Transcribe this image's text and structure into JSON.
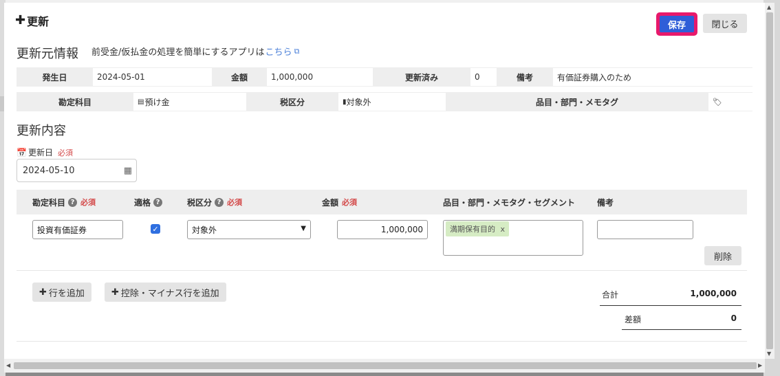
{
  "header": {
    "title": "更新",
    "save_label": "保存",
    "close_label": "閉じる"
  },
  "source": {
    "heading": "更新元情報",
    "subtitle": "前受金/仮払金の処理を簡単にするアプリは",
    "link_text": "こちら",
    "row1": {
      "date_label": "発生日",
      "date_value": "2024-05-01",
      "amount_label": "金額",
      "amount_value": "1,000,000",
      "updated_label": "更新済み",
      "updated_value": "0",
      "note_label": "備考",
      "note_value": "有価証券購入のため"
    },
    "row2": {
      "account_label": "勘定科目",
      "account_value": "預け金",
      "tax_label": "税区分",
      "tax_value": "対象外",
      "items_label": "品目・部門・メモタグ"
    }
  },
  "content": {
    "heading": "更新内容",
    "date_label": "更新日",
    "required": "必須",
    "date_value": "2024-05-10"
  },
  "table": {
    "col_account": "勘定科目",
    "col_qualified": "適格",
    "col_tax": "税区分",
    "col_amount": "金額",
    "col_items": "品目・部門・メモタグ・セグメント",
    "col_note": "備考",
    "row": {
      "account": "投資有価証券",
      "qualified": true,
      "tax": "対象外",
      "amount": "1,000,000",
      "tag": "満期保有目的",
      "tag_remove": "x",
      "note": ""
    },
    "delete_label": "削除"
  },
  "actions": {
    "add_row": "行を追加",
    "add_minus_row": "控除・マイナス行を追加"
  },
  "summary": {
    "total_label": "合計",
    "total_value": "1,000,000",
    "diff_label": "差額",
    "diff_value": "0"
  },
  "colors": {
    "save_bg": "#2f5ed8",
    "save_border": "#e8196b",
    "tag_bg": "#d6ecc4",
    "required": "#d34848",
    "link": "#4a7fd8"
  }
}
